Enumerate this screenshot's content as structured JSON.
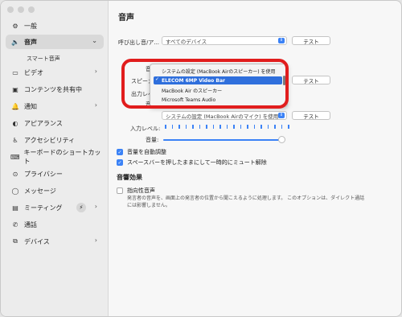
{
  "sidebar": {
    "items": [
      {
        "label": "一般",
        "icon": "gear-icon",
        "glyph": "⚙"
      },
      {
        "label": "音声",
        "icon": "speaker-icon",
        "glyph": "🔈"
      },
      {
        "label": "ビデオ",
        "icon": "video-icon",
        "glyph": "▭"
      },
      {
        "label": "コンテンツを共有中",
        "icon": "share-screen-icon",
        "glyph": "▣"
      },
      {
        "label": "通知",
        "icon": "bell-icon",
        "glyph": "🔔"
      },
      {
        "label": "アピアランス",
        "icon": "appearance-icon",
        "glyph": "◐"
      },
      {
        "label": "アクセシビリティ",
        "icon": "accessibility-icon",
        "glyph": "♿"
      },
      {
        "label": "キーボードのショートカット",
        "icon": "keyboard-icon",
        "glyph": "⌨"
      },
      {
        "label": "プライバシー",
        "icon": "privacy-icon",
        "glyph": "⊙"
      },
      {
        "label": "メッセージ",
        "icon": "message-icon",
        "glyph": "◯"
      },
      {
        "label": "ミーティング",
        "icon": "meeting-icon",
        "glyph": "▤"
      },
      {
        "label": "通話",
        "icon": "phone-icon",
        "glyph": "✆"
      },
      {
        "label": "デバイス",
        "icon": "devices-icon",
        "glyph": "⧉"
      }
    ],
    "sub_item": "スマート音声"
  },
  "main": {
    "title": "音声",
    "ringtone_label": "呼び出し音/ア...",
    "ringtone_value": "すべてのデバイス",
    "test_label": "テスト",
    "speaker_label": "スピーカー",
    "output_level_label": "出力レベル",
    "volume_label": "音量:",
    "mic_value": "システムの設定 (MacBook Airのマイク) を使用",
    "input_level_label": "入力レベル:",
    "auto_adjust_label": "音量を自動調整",
    "spacebar_label": "スペースバーを押したままにして一時的にミュート解除",
    "effects_title": "音響効果",
    "directional_label": "指向性音声",
    "directional_desc": "発言者の音声を、画面上の発言者の位置から聞こえるように処理します。 このオプションは、ダイレクト通話には影響しません。"
  },
  "popup": {
    "options": [
      "システムの設定 (MacBook Airのスピーカー) を使用",
      "ELECOM 6MP Video Bar",
      "MacBook Air のスピーカー",
      "Microsoft Teams Audio"
    ],
    "selected_index": 1
  },
  "colors": {
    "accent": "#3b82f6",
    "highlight_ring": "#e11d1d"
  },
  "sliders": {
    "output_volume": 1.0,
    "input_volume": 1.0
  }
}
